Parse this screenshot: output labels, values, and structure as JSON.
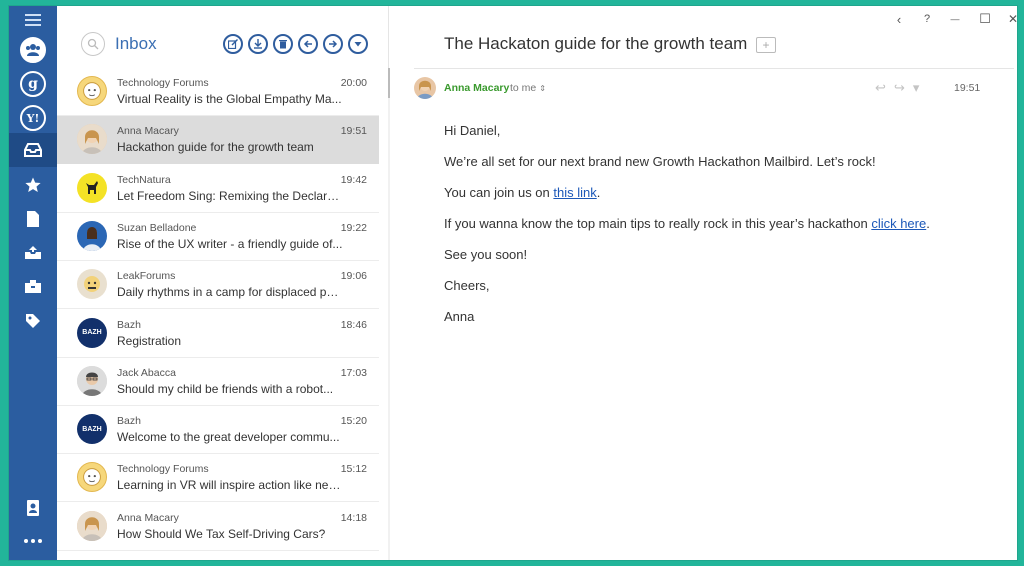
{
  "list": {
    "title": "Inbox",
    "messages": [
      {
        "sender": "Technology Forums",
        "time": "20:00",
        "subject": "Virtual Reality is the Global Empathy Ma...",
        "avatar": "tech"
      },
      {
        "sender": "Anna Macary",
        "time": "19:51",
        "subject": "Hackathon guide for the growth team",
        "avatar": "anna"
      },
      {
        "sender": "TechNatura",
        "time": "19:42",
        "subject": "Let Freedom Sing: Remixing the Declarati...",
        "avatar": "nat"
      },
      {
        "sender": "Suzan Belladone",
        "time": "19:22",
        "subject": "Rise of the UX writer - a friendly guide of...",
        "avatar": "suz"
      },
      {
        "sender": "LeakForums",
        "time": "19:06",
        "subject": "Daily rhythms in a camp for displaced pe...",
        "avatar": "leak"
      },
      {
        "sender": "Bazh",
        "time": "18:46",
        "subject": "Registration",
        "avatar": "bazh",
        "avatar_text": "BAZH"
      },
      {
        "sender": "Jack Abacca",
        "time": "17:03",
        "subject": "Should my child be friends with a robot...",
        "avatar": "jack"
      },
      {
        "sender": "Bazh",
        "time": "15:20",
        "subject": "Welcome to the great developer commu...",
        "avatar": "bazh",
        "avatar_text": "BAZH"
      },
      {
        "sender": "Technology Forums",
        "time": "15:12",
        "subject": "Learning in VR will inspire action like nev...",
        "avatar": "tech"
      },
      {
        "sender": "Anna Macary",
        "time": "14:18",
        "subject": "How Should We Tax Self-Driving Cars?",
        "avatar": "anna"
      }
    ]
  },
  "reader": {
    "subject": "The Hackaton guide for the growth team",
    "from": "Anna Macary",
    "to": "to me",
    "time": "19:51",
    "greeting": "Hi Daniel,",
    "line1": "We’re all set for our next brand new Growth Hackathon Mailbird. Let’s rock!",
    "line2_prefix": "You can join us on ",
    "line2_link": "this link",
    "line2_suffix": ".",
    "line3_prefix": "If you wanna know the top main tips to really rock in this year’s hackathon ",
    "line3_link": "click here",
    "line3_suffix": ".",
    "line4": "See you soon!",
    "line5": "Cheers,",
    "line6": "Anna"
  },
  "window_controls": {
    "back": "‹",
    "help": "?",
    "minimize": "—",
    "maximize": "☐",
    "close": "✕"
  },
  "colors": {
    "sidebar": "#2b5da0",
    "accent": "#3b6fb3",
    "background": "#22b59a",
    "sender_green": "#3a9a2e"
  }
}
